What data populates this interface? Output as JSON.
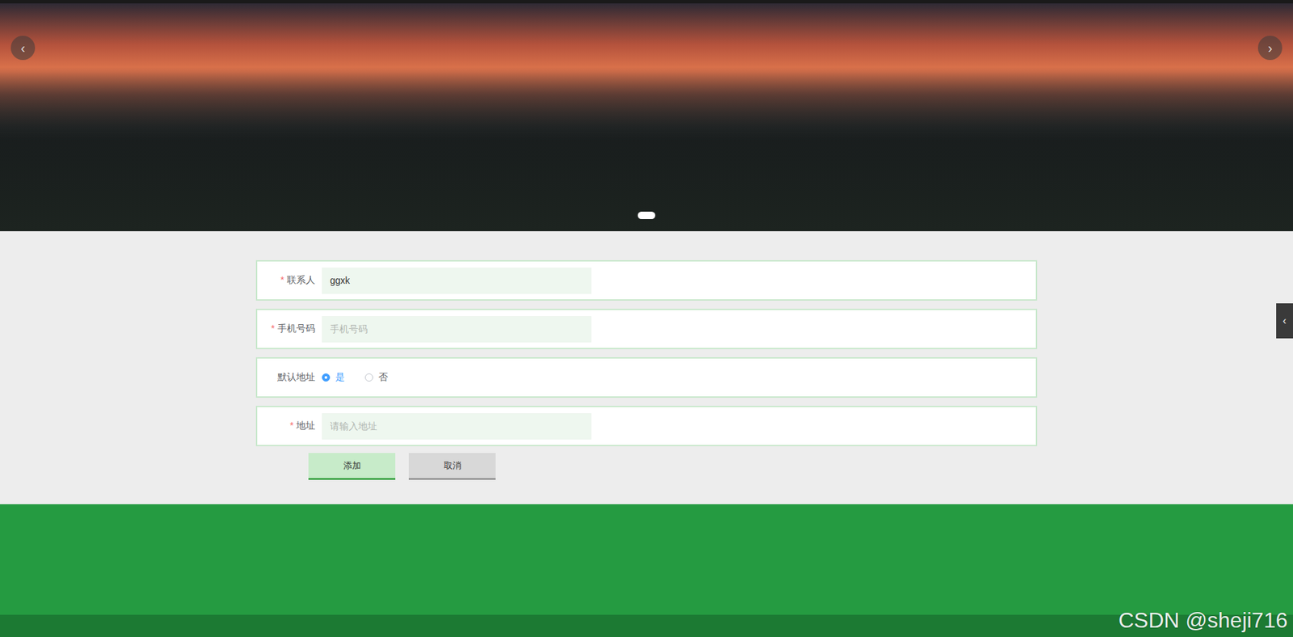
{
  "carousel": {
    "prev": "‹",
    "next": "›",
    "slides": [
      {
        "selected": true
      }
    ]
  },
  "form": {
    "required_mark": "*",
    "fields": [
      {
        "label": "联系人",
        "required": true,
        "kind": "text",
        "value": "ggxk",
        "placeholder": "",
        "focused": true
      },
      {
        "label": "手机号码",
        "required": true,
        "kind": "text",
        "value": "",
        "placeholder": "手机号码",
        "focused": false
      },
      {
        "label": "默认地址",
        "required": false,
        "kind": "radio",
        "options": [
          {
            "label": "是",
            "selected": true
          },
          {
            "label": "否",
            "selected": false
          }
        ]
      },
      {
        "label": "地址",
        "required": true,
        "kind": "text",
        "value": "",
        "placeholder": "请输入地址",
        "focused": false
      }
    ]
  },
  "buttons": [
    {
      "label": "添加",
      "kind": "primary"
    },
    {
      "label": "取消",
      "kind": "secondary"
    }
  ],
  "side_toggle": "‹",
  "watermark": "CSDN @sheji716"
}
